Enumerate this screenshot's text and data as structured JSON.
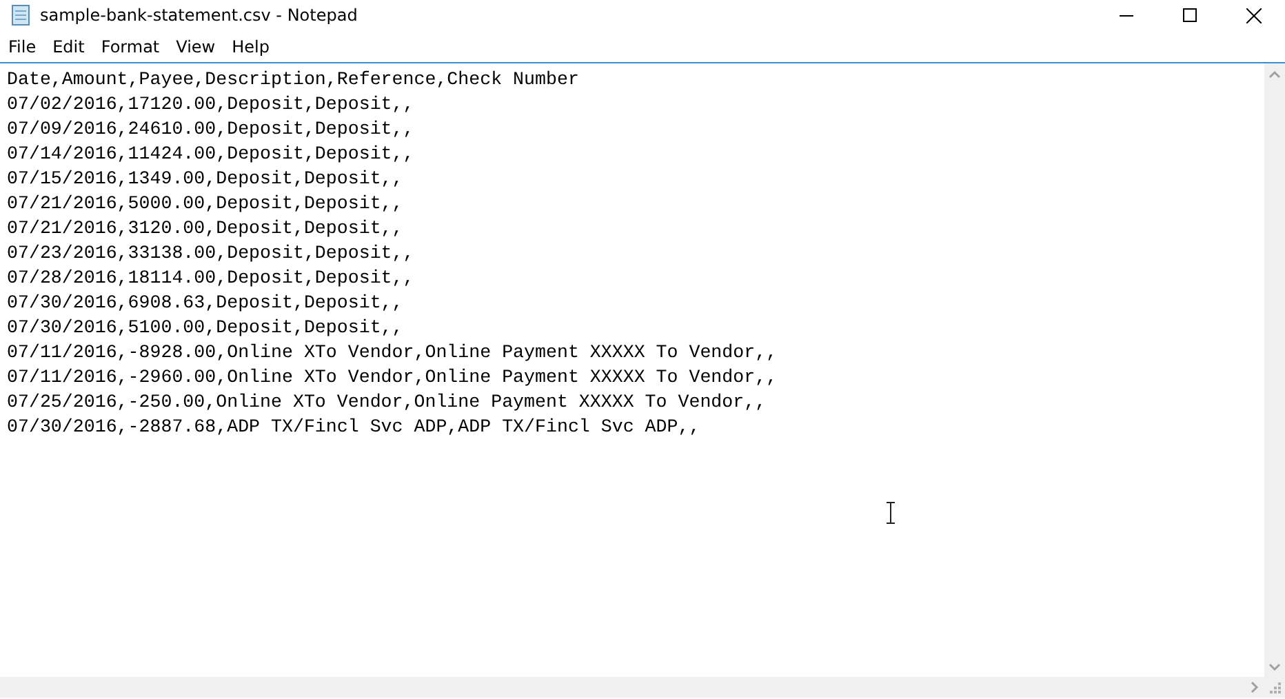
{
  "window": {
    "title": "sample-bank-statement.csv - Notepad"
  },
  "menu": [
    "File",
    "Edit",
    "Format",
    "View",
    "Help"
  ],
  "editor": {
    "lines": [
      "Date,Amount,Payee,Description,Reference,Check Number",
      "07/02/2016,17120.00,Deposit,Deposit,,",
      "07/09/2016,24610.00,Deposit,Deposit,,",
      "07/14/2016,11424.00,Deposit,Deposit,,",
      "07/15/2016,1349.00,Deposit,Deposit,,",
      "07/21/2016,5000.00,Deposit,Deposit,,",
      "07/21/2016,3120.00,Deposit,Deposit,,",
      "07/23/2016,33138.00,Deposit,Deposit,,",
      "07/28/2016,18114.00,Deposit,Deposit,,",
      "07/30/2016,6908.63,Deposit,Deposit,,",
      "07/30/2016,5100.00,Deposit,Deposit,,",
      "07/11/2016,-8928.00,Online XTo Vendor,Online Payment XXXXX To Vendor,,",
      "07/11/2016,-2960.00,Online XTo Vendor,Online Payment XXXXX To Vendor,,",
      "07/25/2016,-250.00,Online XTo Vendor,Online Payment XXXXX To Vendor,,",
      "07/30/2016,-2887.68,ADP TX/Fincl Svc ADP,ADP TX/Fincl Svc ADP,,"
    ]
  }
}
